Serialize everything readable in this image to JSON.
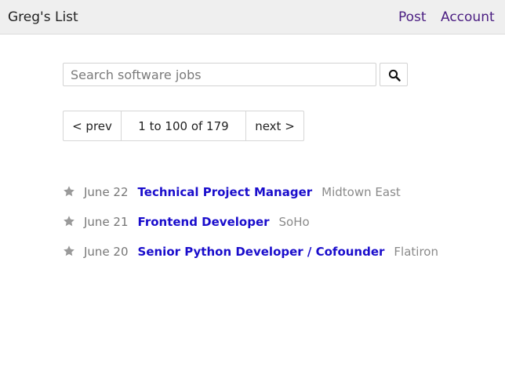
{
  "header": {
    "brand": "Greg's List",
    "nav": {
      "post": "Post",
      "account": "Account"
    }
  },
  "search": {
    "placeholder": "Search software jobs",
    "value": "",
    "button_icon": "search-icon"
  },
  "pagination": {
    "prev_label": "< prev",
    "range_text": "1 to 100 of 179",
    "next_label": "next >"
  },
  "jobs": [
    {
      "date": "June 22",
      "title": "Technical Project Manager",
      "neighborhood": "Midtown East",
      "icon": "star-icon"
    },
    {
      "date": "June 21",
      "title": "Frontend Developer",
      "neighborhood": "SoHo",
      "icon": "star-icon"
    },
    {
      "date": "June 20",
      "title": "Senior Python Developer / Cofounder",
      "neighborhood": "Flatiron",
      "icon": "star-icon"
    }
  ],
  "colors": {
    "topbar_bg": "#efefef",
    "nav_link": "#4b1e82",
    "job_link": "#1a0dcc",
    "muted_text": "#777777",
    "star": "#9a9a9a"
  }
}
